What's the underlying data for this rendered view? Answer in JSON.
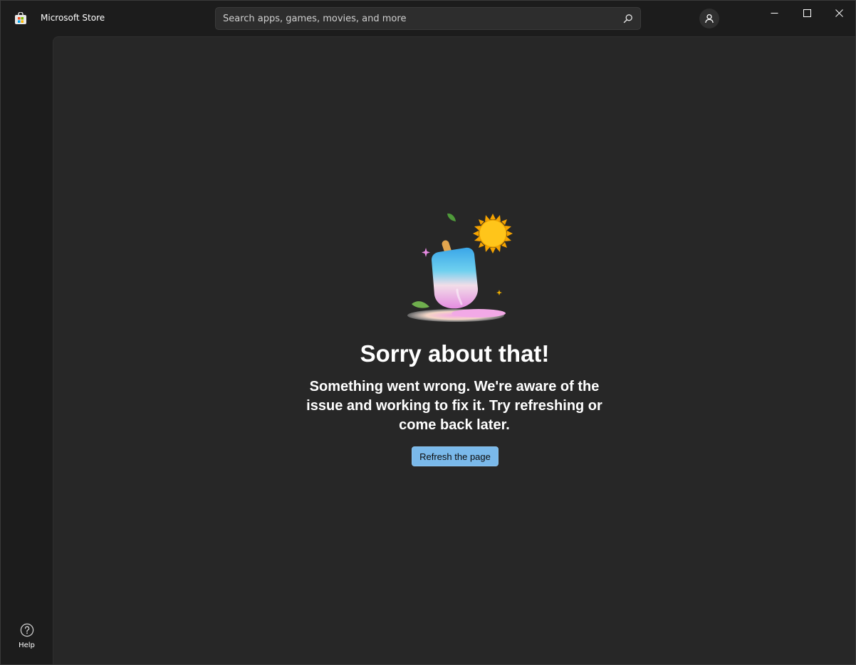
{
  "app": {
    "title": "Microsoft Store",
    "logo_icon": "store-bag-icon"
  },
  "search": {
    "placeholder": "Search apps, games, movies, and more",
    "value": "",
    "icon": "search-icon"
  },
  "account": {
    "icon": "person-icon"
  },
  "window_controls": {
    "minimize_icon": "minimize-icon",
    "maximize_icon": "maximize-icon",
    "close_icon": "close-icon"
  },
  "sidebar": {
    "help_label": "Help",
    "help_icon": "help-icon"
  },
  "error": {
    "illustration": "melting-popsicle-illustration",
    "title": "Sorry about that!",
    "message": "Something went wrong. We're aware of the issue and working to fix it. Try refreshing or come back later.",
    "button_label": "Refresh the page"
  },
  "colors": {
    "background": "#1c1c1c",
    "panel": "#272727",
    "accent": "#7ab9ea",
    "text": "#ffffff"
  }
}
